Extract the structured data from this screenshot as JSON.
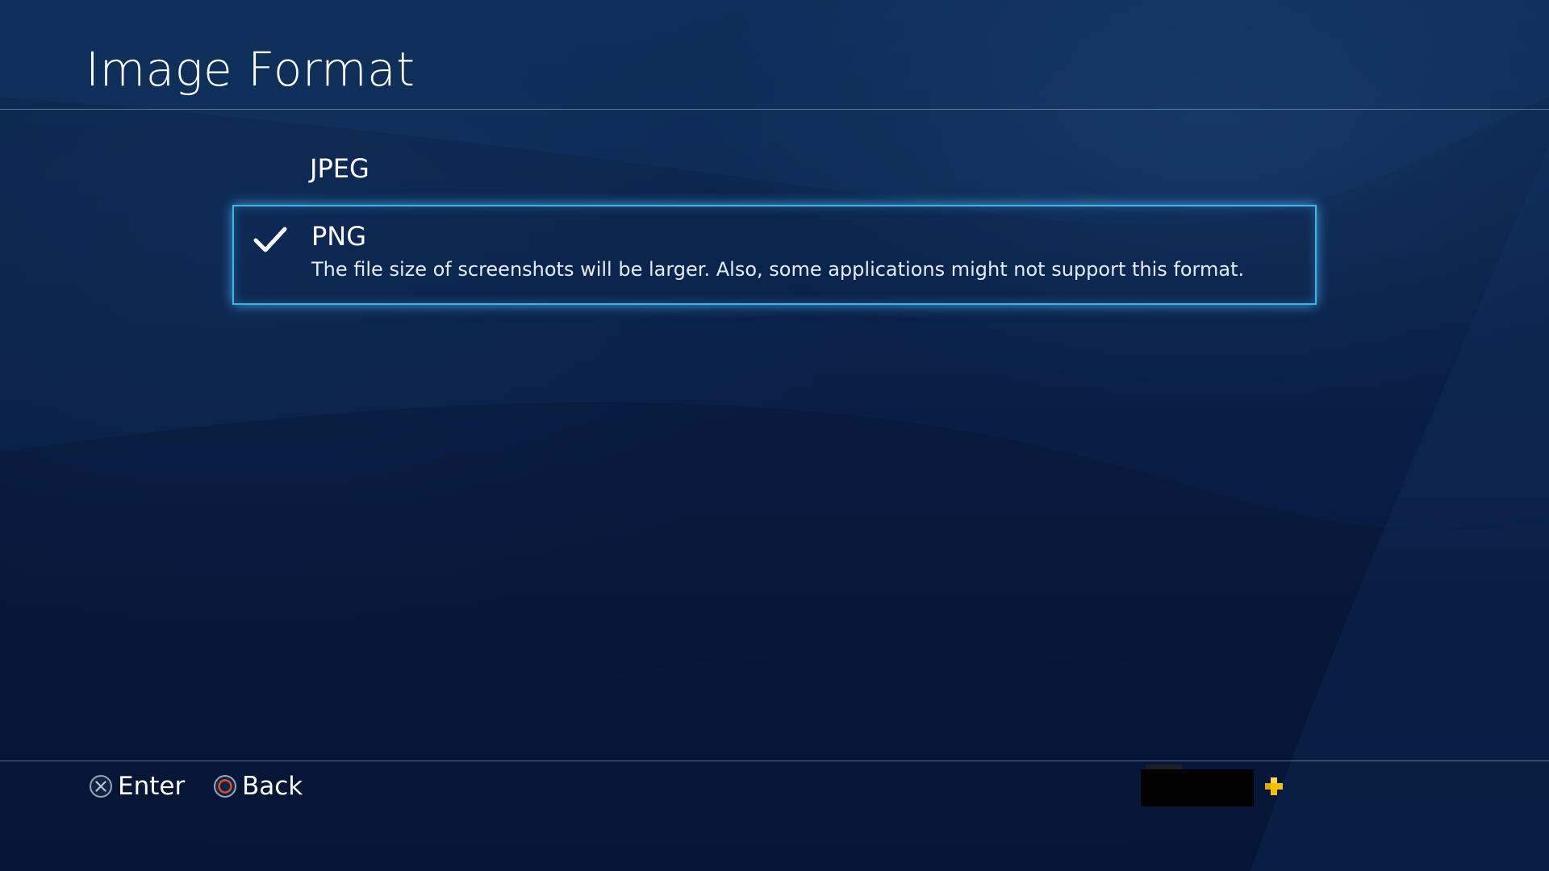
{
  "header": {
    "title": "Image Format"
  },
  "options": [
    {
      "label": "JPEG",
      "selected": false
    },
    {
      "label": "PNG",
      "selected": true,
      "description": "The file size of screenshots will be larger. Also, some applications might not support this format."
    }
  ],
  "footer": {
    "enter_label": "Enter",
    "back_label": "Back",
    "enter_icon": "cross-button-icon",
    "back_icon": "circle-button-icon",
    "plus_icon": "playstation-plus-icon"
  },
  "colors": {
    "background": "#0a1f45",
    "focus_border": "#3fb4ea",
    "circle_button": "#e0502d",
    "plus_icon": "#f2c200"
  }
}
